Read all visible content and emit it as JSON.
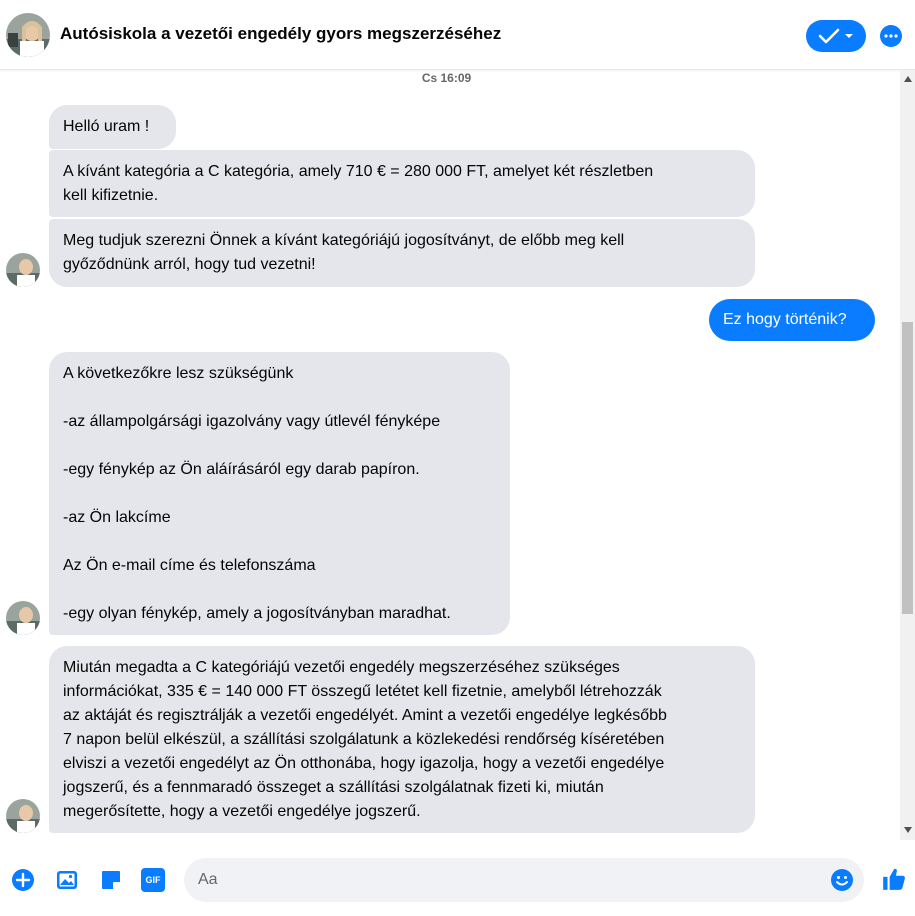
{
  "header": {
    "title": "Autósiskola a vezetői engedély gyors megszerzéséhez"
  },
  "chat": {
    "timestamp": "Cs 16:09",
    "messages": [
      {
        "dir": "in",
        "lines": [
          "Helló uram !"
        ]
      },
      {
        "dir": "in",
        "lines": [
          "A kívánt kategória a C kategória, amely 710 € = 280 000 FT, amelyet két részletben",
          "kell kifizetnie."
        ]
      },
      {
        "dir": "in",
        "lines": [
          "Meg tudjuk szerezni Önnek a kívánt kategóriájú jogosítványt, de előbb meg kell",
          "győződnünk arról, hogy tud vezetni!"
        ]
      },
      {
        "dir": "out",
        "lines": [
          "Ez hogy történik?"
        ]
      },
      {
        "dir": "in",
        "lines": [
          "A következőkre lesz szükségünk",
          "",
          "-az állampolgársági igazolvány vagy útlevél fényképe",
          "",
          "-egy fénykép az Ön aláírásáról egy darab papíron.",
          "",
          "-az Ön lakcíme",
          "",
          "Az Ön e-mail címe és telefonszáma",
          "",
          "-egy olyan fénykép, amely a jogosítványban maradhat."
        ]
      },
      {
        "dir": "in",
        "lines": [
          "Miután megadta a C kategóriájú vezetői engedély megszerzéséhez szükséges",
          "információkat, 335 € = 140 000 FT összegű letétet kell fizetnie, amelyből létrehozzák",
          "az aktáját és regisztrálják a vezetői engedélyét. Amint a vezetői engedélye legkésőbb",
          "7 napon belül elkészül, a szállítási szolgálatunk a közlekedési rendőrség kíséretében",
          "elviszi a vezetői engedélyt az Ön otthonába, hogy igazolja, hogy a vezetői engedélye",
          "jogszerű, és a fennmaradó összeget a szállítási szolgálatnak fizeti ki, miután",
          "megerősítette, hogy a vezetői engedélye jogszerű."
        ]
      }
    ]
  },
  "composer": {
    "placeholder": "Aa",
    "gif_label": "GIF"
  },
  "colors": {
    "accent": "#0a7cff",
    "incoming_bubble": "#e4e6eb"
  },
  "icons": [
    "avatar",
    "check-icon",
    "chevron-down-icon",
    "more-icon",
    "plus-icon",
    "image-icon",
    "sticker-icon",
    "gif-icon",
    "emoji-icon",
    "like-icon"
  ]
}
